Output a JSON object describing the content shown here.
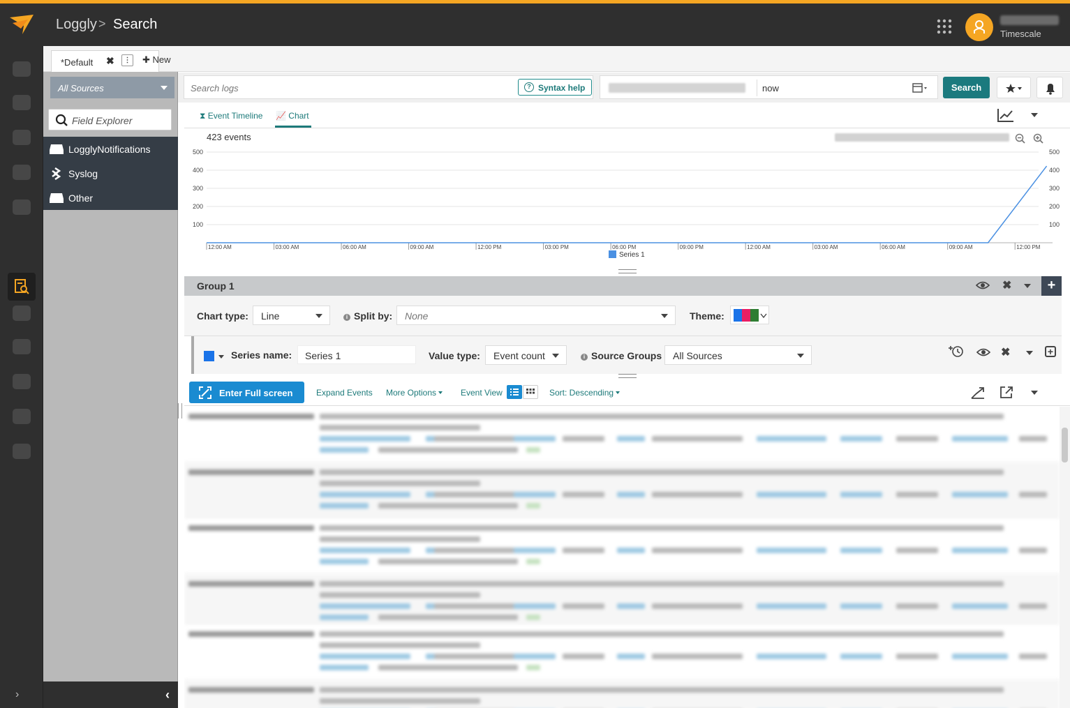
{
  "header": {
    "app_name": "Loggly",
    "breadcrumb_sep": ">",
    "page_title": "Search",
    "org_name": "Timescale",
    "accent_color": "#f5a623"
  },
  "tabs": {
    "default_tab": "*Default",
    "close_glyph": "✖",
    "menu_glyph": "⋮",
    "new_tab": "✚ New"
  },
  "sidebar": {
    "sources_select": "All Sources",
    "field_explorer_placeholder": "Field Explorer",
    "sources": [
      {
        "label": "LogglyNotifications",
        "icon": "server-icon"
      },
      {
        "label": "Syslog",
        "icon": "syslog-icon"
      },
      {
        "label": "Other",
        "icon": "server-icon"
      }
    ],
    "collapse_glyph": "‹",
    "rail_expand_glyph": "›"
  },
  "search": {
    "placeholder": "Search logs",
    "syntax_help": "Syntax help",
    "time_to": "now",
    "search_button": "Search",
    "primary_color": "#1b7a7e"
  },
  "chart_panel": {
    "tabs": [
      "Event Timeline",
      "Chart"
    ],
    "active_tab": "Chart",
    "event_count": "423 events"
  },
  "chart_data": {
    "type": "line",
    "title": "",
    "xlabel": "",
    "ylabel": "",
    "x": [
      "12:00 AM",
      "03:00 AM",
      "06:00 AM",
      "09:00 AM",
      "12:00 PM",
      "03:00 PM",
      "06:00 PM",
      "09:00 PM",
      "12:00 AM",
      "03:00 AM",
      "06:00 AM",
      "09:00 AM",
      "12:00 PM"
    ],
    "y_ticks": [
      100,
      200,
      300,
      400,
      500
    ],
    "ylim": [
      0,
      500
    ],
    "series": [
      {
        "name": "Series 1",
        "color": "#4a90e2",
        "points": [
          [
            0,
            0
          ],
          [
            11.6,
            0
          ],
          [
            12.47,
            423
          ]
        ]
      }
    ],
    "legend": "bottom-center",
    "grid": true
  },
  "group": {
    "title": "Group 1",
    "close_glyph": "✖",
    "add_glyph": "+",
    "chart_type_label": "Chart type:",
    "chart_type_value": "Line",
    "split_by_label": "Split by:",
    "split_by_value": "None",
    "theme_label": "Theme:",
    "theme_colors": [
      "#1a73e8",
      "#e91e63",
      "#2e7d32"
    ],
    "info_glyph": "i"
  },
  "series": {
    "name_label": "Series name:",
    "name_value": "Series 1",
    "value_type_label": "Value type:",
    "value_type_value": "Event count",
    "source_groups_label": "Source Groups",
    "source_groups_value": "All Sources",
    "close_glyph": "✖",
    "add_glyph": "+",
    "color": "#1a73e8"
  },
  "events_toolbar": {
    "fullscreen_button": "Enter Full screen",
    "expand_events": "Expand Events",
    "more_options": "More Options",
    "event_view": "Event View",
    "sort": "Sort: Descending"
  }
}
